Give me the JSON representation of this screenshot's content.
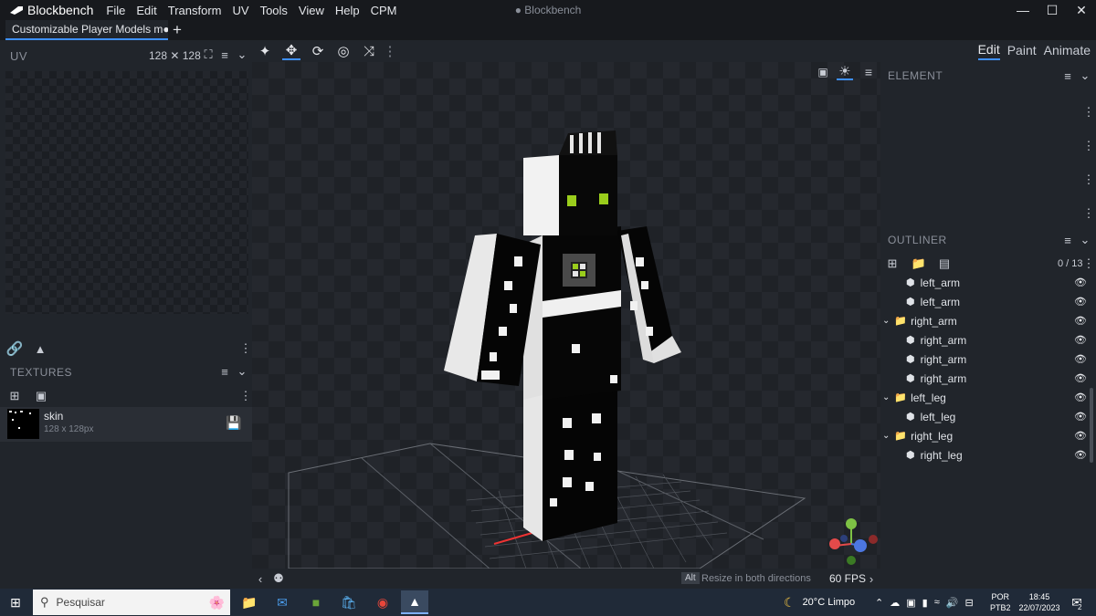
{
  "app": {
    "name": "Blockbench",
    "window_title": "● Blockbench",
    "menu": [
      "File",
      "Edit",
      "Transform",
      "UV",
      "Tools",
      "View",
      "Help",
      "CPM"
    ]
  },
  "tabs": {
    "active_label": "Customizable Player Models m●",
    "add_label": "+"
  },
  "uv_panel": {
    "title": "UV",
    "size_label": "128 ✕ 128"
  },
  "textures_panel": {
    "title": "TEXTURES",
    "items": [
      {
        "name": "skin",
        "size": "128 x 128px"
      }
    ]
  },
  "modes": [
    "Edit",
    "Paint",
    "Animate"
  ],
  "active_mode": "Edit",
  "element_panel": {
    "title": "ELEMENT"
  },
  "outliner": {
    "title": "OUTLINER",
    "count": "0 / 13",
    "items": [
      {
        "label": "left_arm",
        "type": "cube"
      },
      {
        "label": "left_arm",
        "type": "cube"
      },
      {
        "label": "right_arm",
        "type": "group"
      },
      {
        "label": "right_arm",
        "type": "cube"
      },
      {
        "label": "right_arm",
        "type": "cube"
      },
      {
        "label": "right_arm",
        "type": "cube"
      },
      {
        "label": "left_leg",
        "type": "group"
      },
      {
        "label": "left_leg",
        "type": "cube"
      },
      {
        "label": "right_leg",
        "type": "group"
      },
      {
        "label": "right_leg",
        "type": "cube"
      }
    ]
  },
  "statusbar": {
    "key": "Alt",
    "hint": "Resize in both directions",
    "fps": "60 FPS"
  },
  "taskbar": {
    "search_placeholder": "Pesquisar",
    "weather": "20°C  Limpo",
    "lang_top": "POR",
    "lang_bottom": "PTB2",
    "time": "18:45",
    "date": "22/07/2023",
    "notifications": "2"
  },
  "colors": {
    "accent": "#3e90ff",
    "model_accent": "#9acd1c"
  }
}
